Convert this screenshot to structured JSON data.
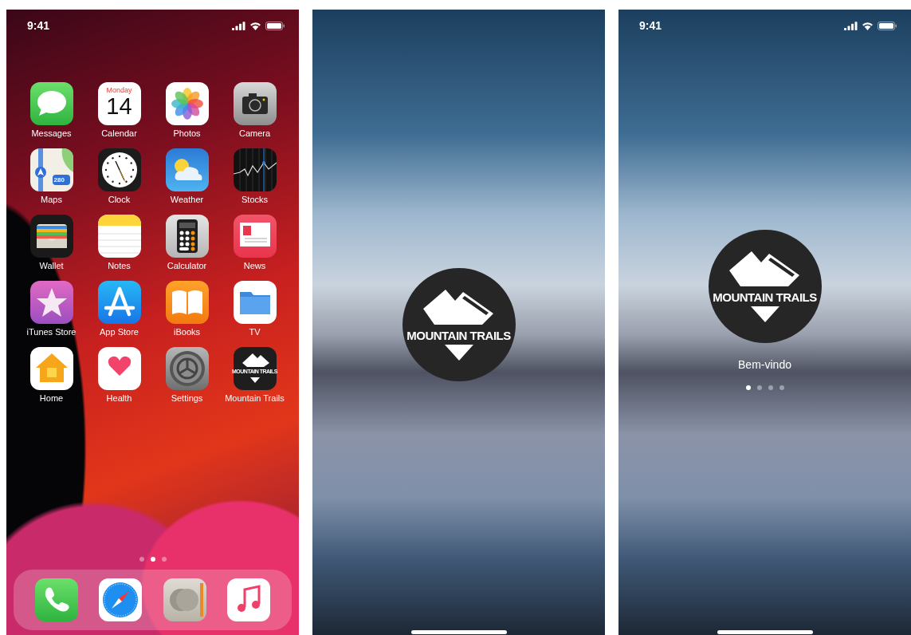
{
  "screens": [
    {
      "kind": "home",
      "status_bar": {
        "time": "9:41"
      },
      "apps": [
        {
          "kind": "messages",
          "label": "Messages"
        },
        {
          "kind": "calendar",
          "label": "Calendar",
          "weekday": "Monday",
          "day": "14"
        },
        {
          "kind": "photos",
          "label": "Photos"
        },
        {
          "kind": "camera",
          "label": "Camera"
        },
        {
          "kind": "maps",
          "label": "Maps",
          "shield": "280"
        },
        {
          "kind": "clock",
          "label": "Clock"
        },
        {
          "kind": "weather",
          "label": "Weather"
        },
        {
          "kind": "stocks",
          "label": "Stocks"
        },
        {
          "kind": "wallet",
          "label": "Wallet"
        },
        {
          "kind": "notes",
          "label": "Notes"
        },
        {
          "kind": "calculator",
          "label": "Calculator"
        },
        {
          "kind": "news",
          "label": "News"
        },
        {
          "kind": "itunes",
          "label": "iTunes Store"
        },
        {
          "kind": "appstore",
          "label": "App Store"
        },
        {
          "kind": "books",
          "label": "iBooks"
        },
        {
          "kind": "tv",
          "label": "TV"
        },
        {
          "kind": "home",
          "label": "Home"
        },
        {
          "kind": "health",
          "label": "Health"
        },
        {
          "kind": "settings",
          "label": "Settings"
        },
        {
          "kind": "trails",
          "label": "Mountain Trails",
          "logo_text": "MOUNTAIN TRAILS"
        }
      ],
      "page_dots": [
        {
          "selected": false
        },
        {
          "selected": true
        },
        {
          "selected": false
        }
      ],
      "dock": [
        {
          "kind": "phone"
        },
        {
          "kind": "safari"
        },
        {
          "kind": "contacts"
        },
        {
          "kind": "music"
        }
      ]
    },
    {
      "kind": "splash",
      "logo": {
        "text": "MOUNTAIN TRAILS"
      }
    },
    {
      "kind": "splash",
      "status_bar": {
        "time": "9:41"
      },
      "logo": {
        "text": "MOUNTAIN TRAILS"
      },
      "caption": "Bem-vindo",
      "page_dots": [
        {
          "selected": true
        },
        {
          "selected": false
        },
        {
          "selected": false
        },
        {
          "selected": false
        }
      ]
    }
  ]
}
